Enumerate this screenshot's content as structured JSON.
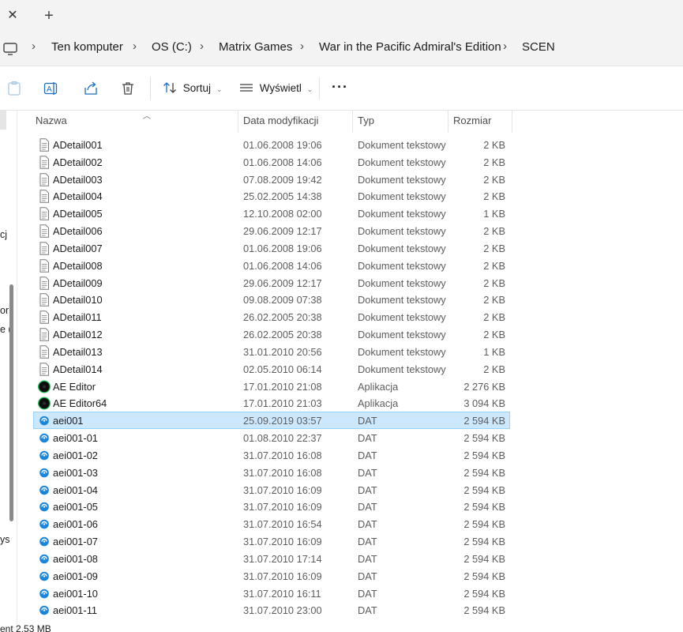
{
  "tabstrip": {
    "close_glyph": "✕",
    "new_tab_glyph": "+"
  },
  "breadcrumb": {
    "icon": "monitor-icon",
    "separator": "›",
    "items": [
      "Ten komputer",
      "OS (C:)",
      "Matrix Games",
      "War in the Pacific Admiral's Edition",
      "SCEN"
    ]
  },
  "toolbar": {
    "sort_label": "Sortuj",
    "view_label": "Wyświetl",
    "more_glyph": "···",
    "icons": [
      "paste-icon",
      "rename-icon",
      "share-icon",
      "delete-icon"
    ]
  },
  "nav_fragments": [
    "cj",
    "or",
    "e (",
    "ys"
  ],
  "columns": {
    "name": "Nazwa",
    "date": "Data modyfikacji",
    "type": "Typ",
    "size": "Rozmiar"
  },
  "files": [
    {
      "name": "ADetail001",
      "date": "01.06.2008 19:06",
      "type": "Dokument tekstowy",
      "size": "2 KB",
      "icon": "text-file-icon"
    },
    {
      "name": "ADetail002",
      "date": "01.06.2008 14:06",
      "type": "Dokument tekstowy",
      "size": "2 KB",
      "icon": "text-file-icon"
    },
    {
      "name": "ADetail003",
      "date": "07.08.2009 19:42",
      "type": "Dokument tekstowy",
      "size": "2 KB",
      "icon": "text-file-icon"
    },
    {
      "name": "ADetail004",
      "date": "25.02.2005 14:38",
      "type": "Dokument tekstowy",
      "size": "2 KB",
      "icon": "text-file-icon"
    },
    {
      "name": "ADetail005",
      "date": "12.10.2008 02:00",
      "type": "Dokument tekstowy",
      "size": "1 KB",
      "icon": "text-file-icon"
    },
    {
      "name": "ADetail006",
      "date": "29.06.2009 12:17",
      "type": "Dokument tekstowy",
      "size": "2 KB",
      "icon": "text-file-icon"
    },
    {
      "name": "ADetail007",
      "date": "01.06.2008 19:06",
      "type": "Dokument tekstowy",
      "size": "2 KB",
      "icon": "text-file-icon"
    },
    {
      "name": "ADetail008",
      "date": "01.06.2008 14:06",
      "type": "Dokument tekstowy",
      "size": "2 KB",
      "icon": "text-file-icon"
    },
    {
      "name": "ADetail009",
      "date": "29.06.2009 12:17",
      "type": "Dokument tekstowy",
      "size": "2 KB",
      "icon": "text-file-icon"
    },
    {
      "name": "ADetail010",
      "date": "09.08.2009 07:38",
      "type": "Dokument tekstowy",
      "size": "2 KB",
      "icon": "text-file-icon"
    },
    {
      "name": "ADetail011",
      "date": "26.02.2005 20:38",
      "type": "Dokument tekstowy",
      "size": "2 KB",
      "icon": "text-file-icon"
    },
    {
      "name": "ADetail012",
      "date": "26.02.2005 20:38",
      "type": "Dokument tekstowy",
      "size": "2 KB",
      "icon": "text-file-icon"
    },
    {
      "name": "ADetail013",
      "date": "31.01.2010 20:56",
      "type": "Dokument tekstowy",
      "size": "1 KB",
      "icon": "text-file-icon"
    },
    {
      "name": "ADetail014",
      "date": "02.05.2010 06:14",
      "type": "Dokument tekstowy",
      "size": "2 KB",
      "icon": "text-file-icon"
    },
    {
      "name": "AE Editor",
      "date": "17.01.2010 21:08",
      "type": "Aplikacja",
      "size": "2 276 KB",
      "icon": "app-icon"
    },
    {
      "name": "AE Editor64",
      "date": "17.01.2010 21:03",
      "type": "Aplikacja",
      "size": "3 094 KB",
      "icon": "app-icon"
    },
    {
      "name": "aei001",
      "date": "25.09.2019 03:57",
      "type": "DAT",
      "size": "2 594 KB",
      "icon": "dat-file-icon",
      "selected": true
    },
    {
      "name": "aei001-01",
      "date": "01.08.2010 22:37",
      "type": "DAT",
      "size": "2 594 KB",
      "icon": "dat-file-icon"
    },
    {
      "name": "aei001-02",
      "date": "31.07.2010 16:08",
      "type": "DAT",
      "size": "2 594 KB",
      "icon": "dat-file-icon"
    },
    {
      "name": "aei001-03",
      "date": "31.07.2010 16:08",
      "type": "DAT",
      "size": "2 594 KB",
      "icon": "dat-file-icon"
    },
    {
      "name": "aei001-04",
      "date": "31.07.2010 16:09",
      "type": "DAT",
      "size": "2 594 KB",
      "icon": "dat-file-icon"
    },
    {
      "name": "aei001-05",
      "date": "31.07.2010 16:09",
      "type": "DAT",
      "size": "2 594 KB",
      "icon": "dat-file-icon"
    },
    {
      "name": "aei001-06",
      "date": "31.07.2010 16:54",
      "type": "DAT",
      "size": "2 594 KB",
      "icon": "dat-file-icon"
    },
    {
      "name": "aei001-07",
      "date": "31.07.2010 16:09",
      "type": "DAT",
      "size": "2 594 KB",
      "icon": "dat-file-icon"
    },
    {
      "name": "aei001-08",
      "date": "31.07.2010 17:14",
      "type": "DAT",
      "size": "2 594 KB",
      "icon": "dat-file-icon"
    },
    {
      "name": "aei001-09",
      "date": "31.07.2010 16:09",
      "type": "DAT",
      "size": "2 594 KB",
      "icon": "dat-file-icon"
    },
    {
      "name": "aei001-10",
      "date": "31.07.2010 16:11",
      "type": "DAT",
      "size": "2 594 KB",
      "icon": "dat-file-icon"
    },
    {
      "name": "aei001-11",
      "date": "31.07.2010 23:00",
      "type": "DAT",
      "size": "2 594 KB",
      "icon": "dat-file-icon"
    }
  ],
  "status_bar": {
    "text": "ent  2,53 MB"
  },
  "colors": {
    "selection_bg": "#cce8ff",
    "selection_border": "#99d1ff",
    "dat_icon": "#1a86d9",
    "app_ring": "#1db954"
  }
}
